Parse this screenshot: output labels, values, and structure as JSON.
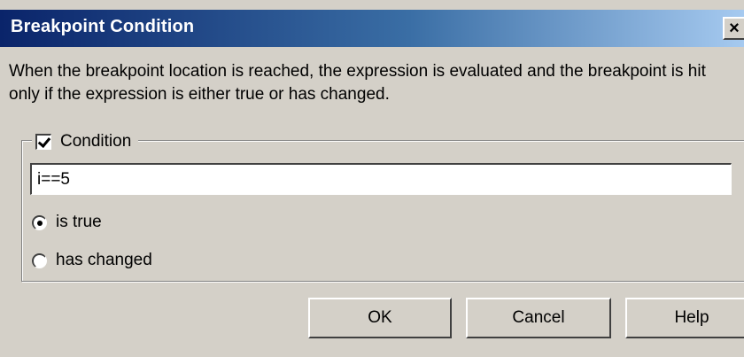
{
  "window": {
    "title": "Breakpoint Condition",
    "close_glyph": "×"
  },
  "description": "When the breakpoint location is reached, the expression is evaluated and the breakpoint is hit only if the expression is either true or has changed.",
  "condition": {
    "label": "Condition",
    "checked": true,
    "value": "i==5"
  },
  "options": [
    {
      "label": "is true",
      "selected": true
    },
    {
      "label": "has changed",
      "selected": false
    }
  ],
  "buttons": {
    "ok": "OK",
    "cancel": "Cancel",
    "help": "Help"
  }
}
